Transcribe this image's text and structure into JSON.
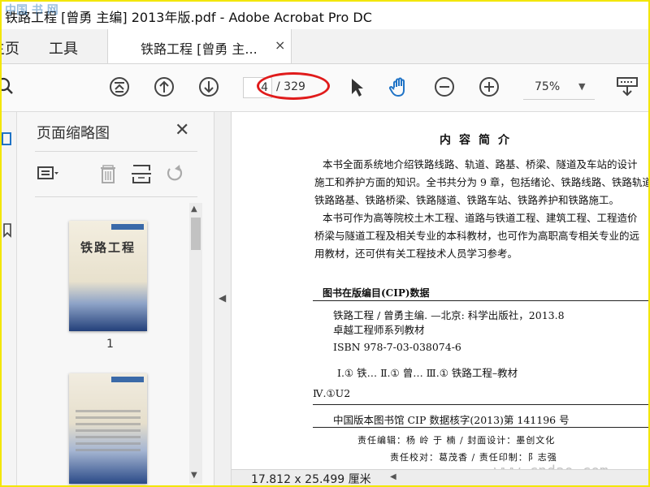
{
  "window": {
    "title": "铁路工程 [曾勇 主编] 2013年版.pdf - Adobe Acrobat Pro DC",
    "watermark_top": "中国 书 网"
  },
  "tabs": {
    "home": "主页",
    "tools": "工具",
    "document": "铁路工程 [曾勇 主...",
    "close": "×"
  },
  "toolbar": {
    "current_page": "4",
    "total_pages": "/ 329",
    "zoom": "75%",
    "zoom_caret": "▼",
    "icons": [
      "search-icon",
      "first-page-icon",
      "prev-page-icon",
      "next-page-icon",
      "select-arrow-icon",
      "hand-tool-icon",
      "zoom-out-icon",
      "zoom-in-icon",
      "keyboard-icon"
    ]
  },
  "thumbnails": {
    "panel_title": "页面缩略图",
    "close": "✕",
    "page1_label": "1",
    "cover_title": "铁路工程",
    "tool_icons": [
      "options-menu-icon",
      "delete-icon",
      "extract-pages-icon",
      "rotate-icon"
    ]
  },
  "document": {
    "heading": "内容简介",
    "paragraphs": [
      "本书全面系统地介绍铁路线路、轨道、路基、桥梁、隧道及车站的设计",
      "施工和养护方面的知识。全书共分为 9 章，包括绪论、铁路线路、铁路轨道",
      "铁路路基、铁路桥梁、铁路隧道、铁路车站、铁路养护和铁路施工。",
      "本书可作为高等院校土木工程、道路与铁道工程、建筑工程、工程造价",
      "桥梁与隧道工程及相关专业的本科教材，也可作为高职高专相关专业的远",
      "用教材，还可供有关工程技术人员学习参考。"
    ],
    "cip_heading": "图书在版编目(CIP)数据",
    "cip_lines": [
      "铁路工程 / 曾勇主编. —北京: 科学出版社，2013.8",
      "卓越工程师系列教材",
      "ISBN 978-7-03-038074-6",
      "Ⅰ.① 铁…   Ⅱ.① 曾…   Ⅲ.① 铁路工程–教材",
      "Ⅳ.①U2",
      "中国版本图书馆 CIP 数据核字(2013)第 141196 号"
    ],
    "credits": [
      "责任编辑：杨  岭  于  楠 / 封面设计：墨创文化",
      "责任校对：葛茂香 / 责任印制：阝志强"
    ],
    "watermark": "www.cndao.com"
  },
  "status": {
    "dimensions": "17.812 x 25.499 厘米"
  },
  "colors": {
    "frame": "#f3e600",
    "annotation_ellipse": "#e01b1b",
    "hand_tool": "#1f73c6"
  }
}
